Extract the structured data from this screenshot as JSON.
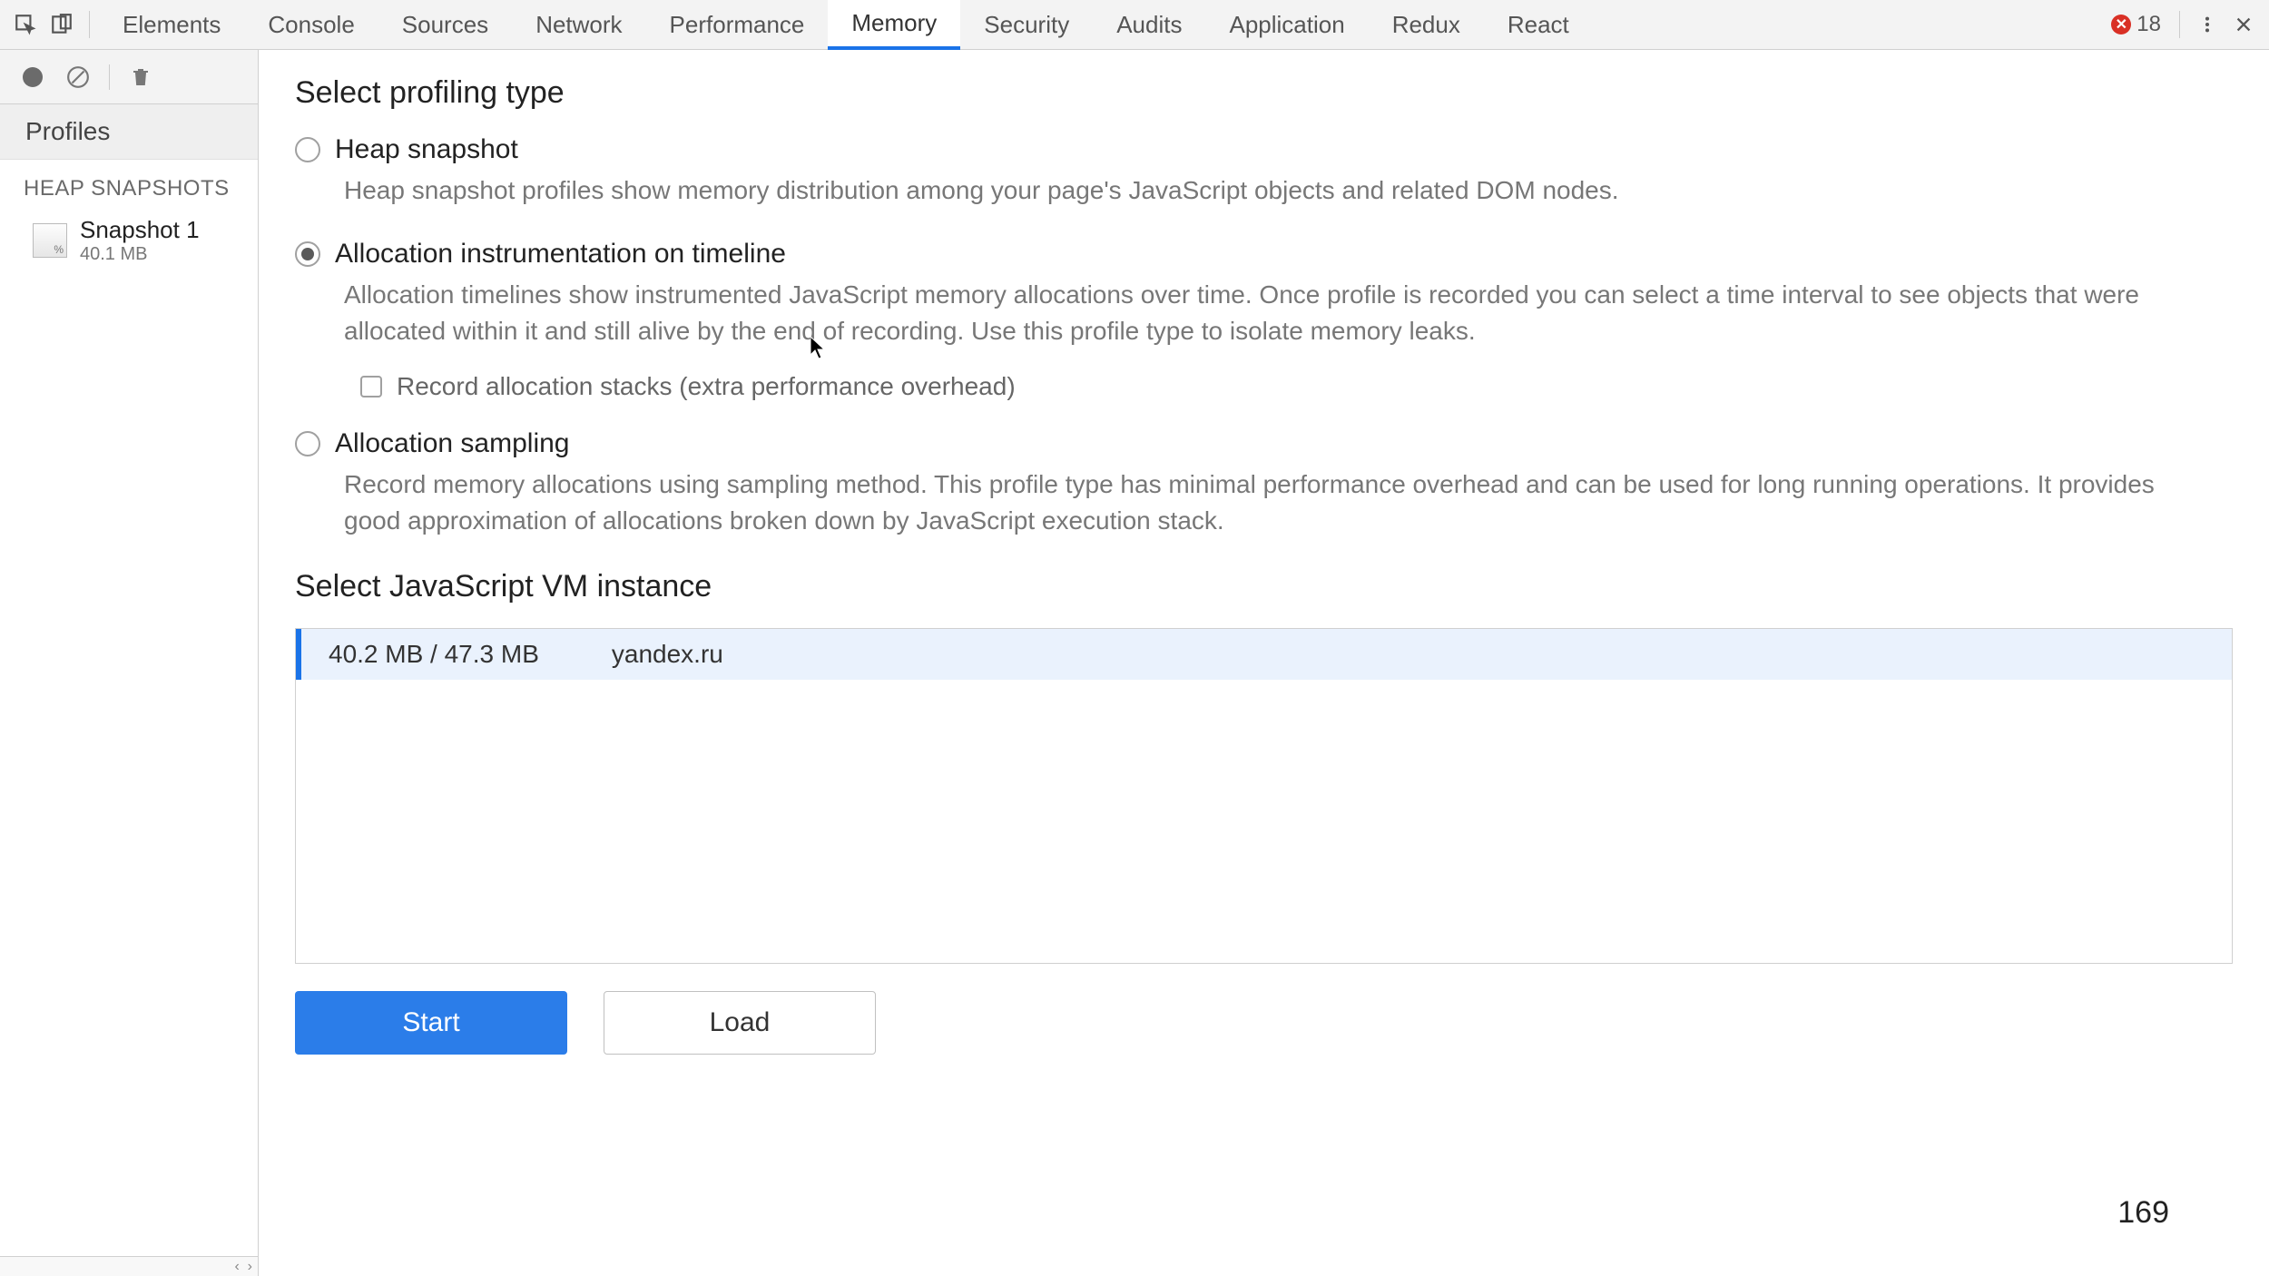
{
  "tabs": {
    "items": [
      "Elements",
      "Console",
      "Sources",
      "Network",
      "Performance",
      "Memory",
      "Security",
      "Audits",
      "Application",
      "Redux",
      "React"
    ],
    "active_index": 5,
    "error_count": "18"
  },
  "sidebar": {
    "profiles_label": "Profiles",
    "section_label": "HEAP SNAPSHOTS",
    "snapshot": {
      "name": "Snapshot 1",
      "size": "40.1 MB"
    }
  },
  "main": {
    "section1_title": "Select profiling type",
    "options": [
      {
        "label": "Heap snapshot",
        "desc": "Heap snapshot profiles show memory distribution among your page's JavaScript objects and related DOM nodes."
      },
      {
        "label": "Allocation instrumentation on timeline",
        "desc": "Allocation timelines show instrumented JavaScript memory allocations over time. Once profile is recorded you can select a time interval to see objects that were allocated within it and still alive by the end of recording. Use this profile type to isolate memory leaks.",
        "checkbox_label": "Record allocation stacks (extra performance overhead)"
      },
      {
        "label": "Allocation sampling",
        "desc": "Record memory allocations using sampling method. This profile type has minimal performance overhead and can be used for long running operations. It provides good approximation of allocations broken down by JavaScript execution stack."
      }
    ],
    "selected_option_index": 1,
    "section2_title": "Select JavaScript VM instance",
    "vm_instance": {
      "memory": "40.2 MB / 47.3 MB",
      "url": "yandex.ru"
    },
    "start_label": "Start",
    "load_label": "Load",
    "page_number": "169"
  }
}
